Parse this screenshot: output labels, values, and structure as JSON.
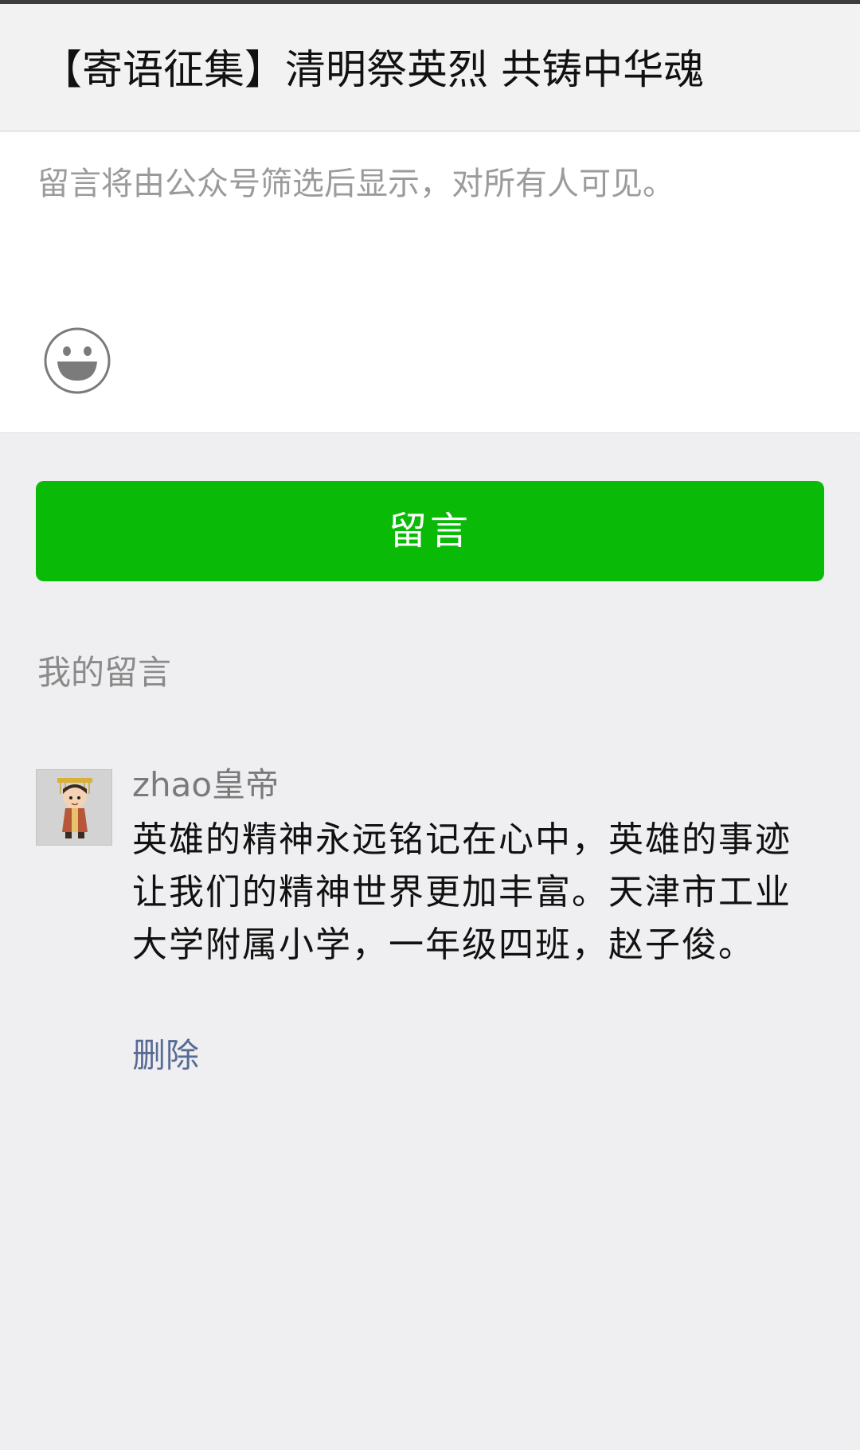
{
  "header": {
    "title": "【寄语征集】清明祭英烈 共铸中华魂"
  },
  "compose": {
    "placeholder": "留言将由公众号筛选后显示，对所有人可见。",
    "emoji_icon": "smiley-face-icon"
  },
  "submit": {
    "label": "留言",
    "color": "#09bb07"
  },
  "my_comments": {
    "heading": "我的留言",
    "items": [
      {
        "author": "zhao皇帝",
        "avatar_icon": "emperor-cartoon-avatar",
        "content": "英雄的精神永远铭记在心中，英雄的事迹让我们的精神世界更加丰富。天津市工业大学附属小学，一年级四班，赵子俊。",
        "delete_label": "删除"
      }
    ]
  },
  "colors": {
    "link": "#576b95",
    "background": "#efeff1"
  }
}
